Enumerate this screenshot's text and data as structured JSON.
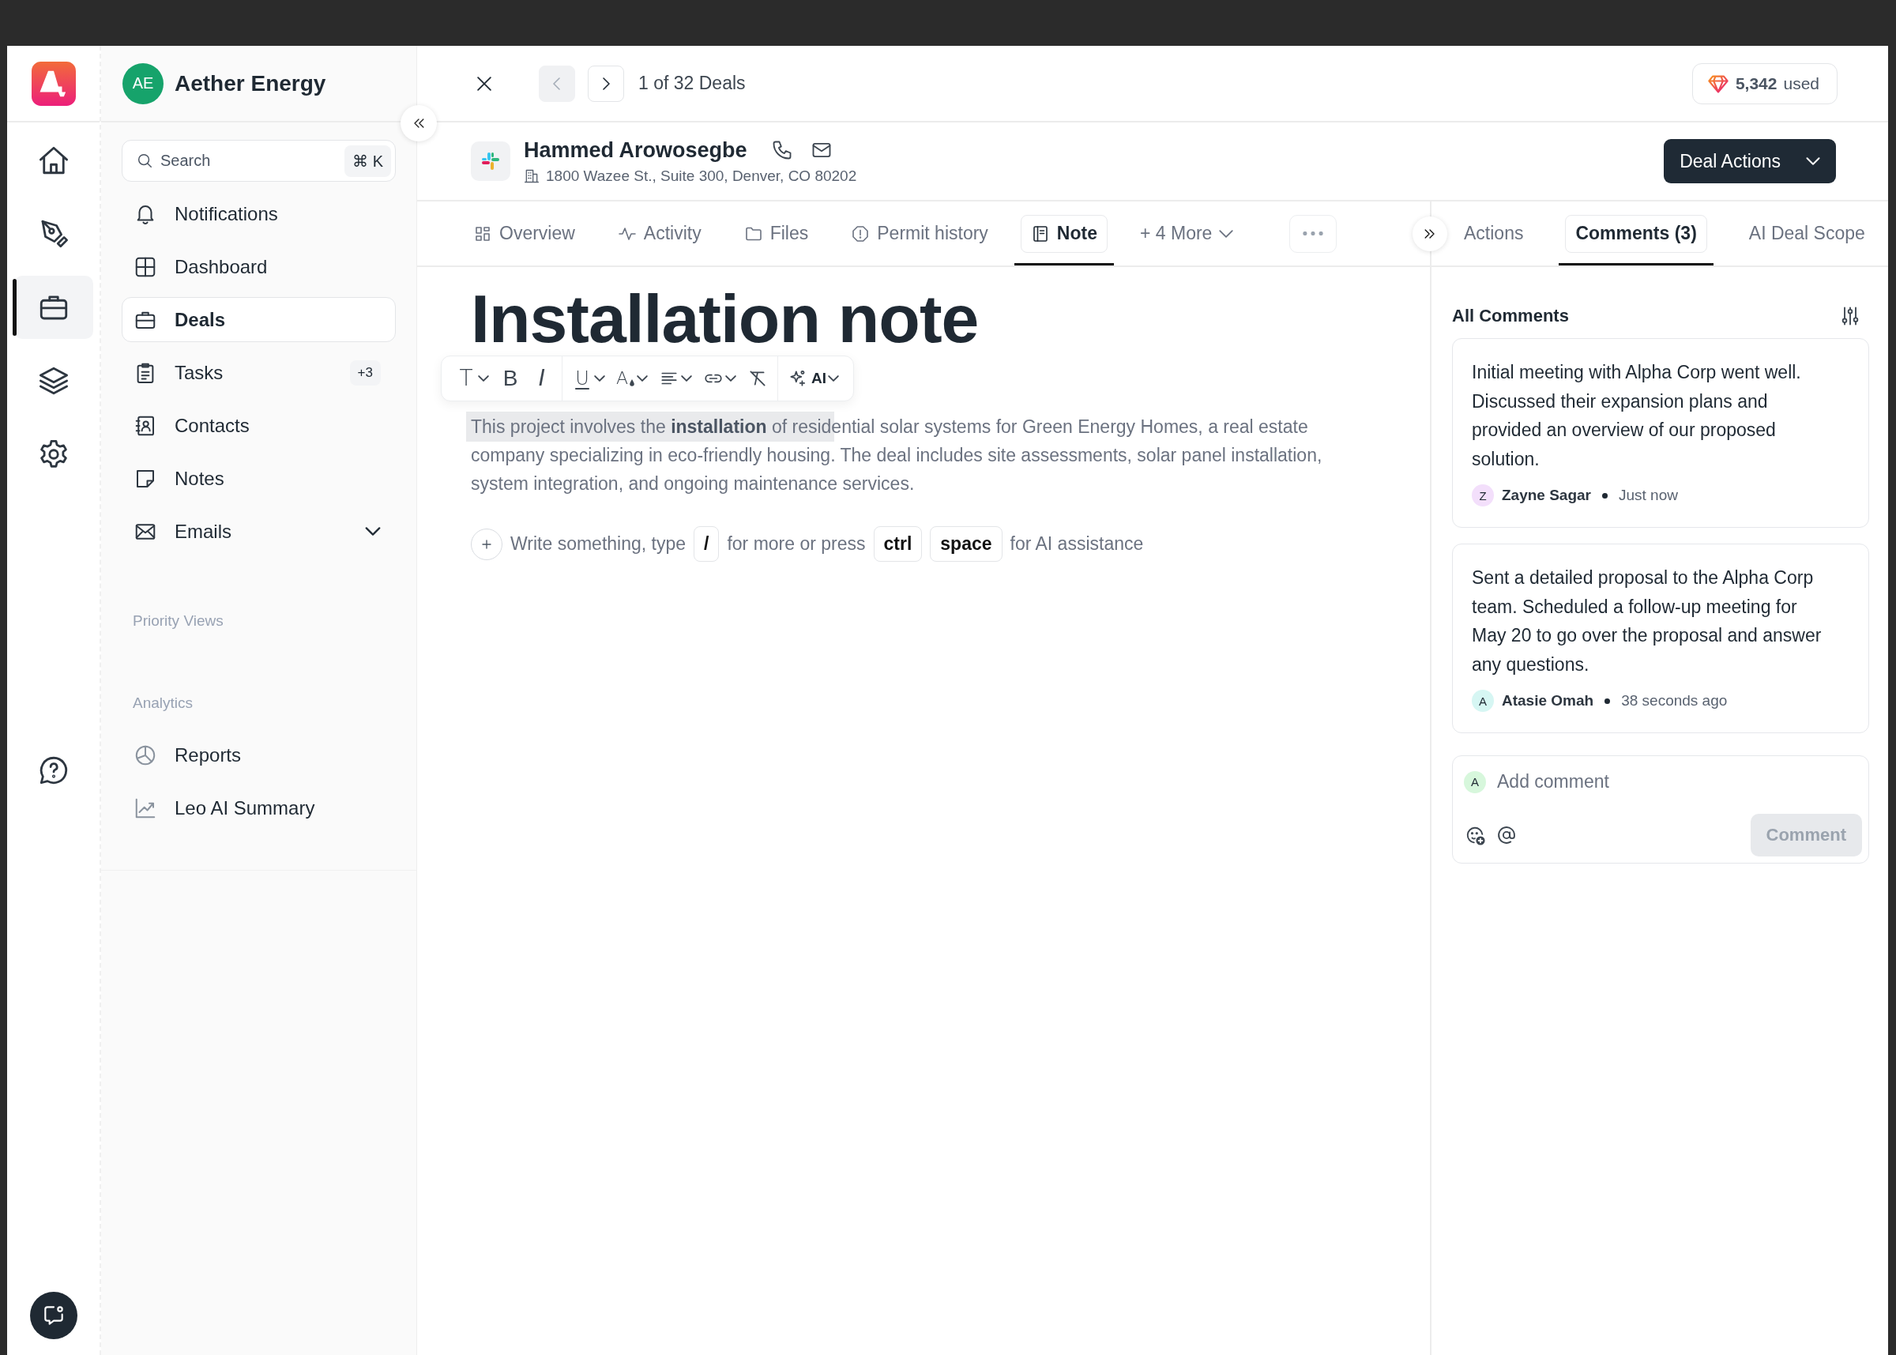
{
  "rail": {
    "items": [
      {
        "kind": "home",
        "selected": false
      },
      {
        "kind": "pen",
        "selected": false
      },
      {
        "kind": "briefcase",
        "selected": true
      },
      {
        "kind": "layers",
        "selected": false
      },
      {
        "kind": "gear",
        "selected": false
      }
    ]
  },
  "workspace": {
    "initials": "AE",
    "name": "Aether Energy"
  },
  "search": {
    "placeholder": "Search",
    "shortcut": "⌘ K"
  },
  "nav_items": [
    {
      "kind": "bell",
      "label": "Notifications",
      "selected": false,
      "collapsible": false
    },
    {
      "kind": "dashboard",
      "label": "Dashboard",
      "selected": false,
      "collapsible": false
    },
    {
      "kind": "briefcase",
      "label": "Deals",
      "selected": true,
      "collapsible": false
    },
    {
      "kind": "tasks",
      "label": "Tasks",
      "selected": false,
      "collapsible": false,
      "badge": "+3"
    },
    {
      "kind": "contacts",
      "label": "Contacts",
      "selected": false,
      "collapsible": false
    },
    {
      "kind": "notes",
      "label": "Notes",
      "selected": false,
      "collapsible": false
    },
    {
      "kind": "mail",
      "label": "Emails",
      "selected": false,
      "collapsible": true
    }
  ],
  "sections": [
    {
      "title": "Priority Views"
    },
    {
      "title": "Analytics",
      "items": [
        {
          "kind": "reports",
          "label": "Reports",
          "selected": false
        },
        {
          "kind": "summary",
          "label": "Leo AI Summary",
          "selected": false
        }
      ]
    }
  ],
  "record_nav": {
    "position": "1 of 32 Deals",
    "prev_disabled": true,
    "next_disabled": false
  },
  "credits": {
    "count": "5,342",
    "unit": "used"
  },
  "contact": {
    "name": "Hammed Arowosegbe",
    "address": "1800 Wazee St., Suite 300, Denver, CO 80202"
  },
  "primary_action": "Deal Actions",
  "tabs": [
    {
      "kind": "overview",
      "label": "Overview",
      "selected": false
    },
    {
      "kind": "activity",
      "label": "Activity",
      "selected": false
    },
    {
      "kind": "files",
      "label": "Files",
      "selected": false
    },
    {
      "kind": "permit",
      "label": "Permit history",
      "selected": false
    },
    {
      "kind": "note",
      "label": "Note",
      "selected": true
    },
    {
      "kind": "more",
      "label": "+ 4 More",
      "selected": false
    }
  ],
  "side_tabs": [
    {
      "label": "Actions",
      "selected": false
    },
    {
      "label": "Comments (3)",
      "selected": true
    },
    {
      "label": "AI Deal Scope",
      "selected": false
    }
  ],
  "note": {
    "title": "Installation note",
    "body": "This project involves the **installation** of residential solar systems for Green Energy Homes, a real estate company specializing in eco-friendly housing. The deal includes site assessments, solar panel installation, system integration, and ongoing maintenance services.",
    "prompt": [
      {
        "kind": "text",
        "text": "Write something, type"
      },
      {
        "kind": "key",
        "text": "/"
      },
      {
        "kind": "text",
        "text": "for more or press"
      },
      {
        "kind": "key",
        "text": "ctrl"
      },
      {
        "kind": "key",
        "text": "space"
      },
      {
        "kind": "text",
        "text": "for AI assistance"
      }
    ]
  },
  "toolbar": [
    [
      {
        "kind": "text-style",
        "glyph": "T",
        "dropdown": true
      },
      {
        "kind": "bold",
        "glyph": "B",
        "dropdown": false
      },
      {
        "kind": "italic",
        "glyph": "I",
        "dropdown": false
      }
    ],
    [
      {
        "kind": "underline",
        "glyph": "U",
        "dropdown": true
      },
      {
        "kind": "color",
        "glyph": "A",
        "dropdown": true
      },
      {
        "kind": "align",
        "dropdown": true
      },
      {
        "kind": "link",
        "dropdown": true
      },
      {
        "kind": "clear",
        "dropdown": false
      }
    ],
    [
      {
        "kind": "ai",
        "glyph": "AI",
        "dropdown": true
      }
    ]
  ],
  "comments": {
    "title": "All Comments",
    "items": [
      {
        "text": "Initial meeting with Alpha Corp went well. Discussed their expansion plans and provided an overview of our proposed solution.",
        "initial": "Z",
        "color": "#f3dffb",
        "author": "Zayne Sagar",
        "time": "Just now"
      },
      {
        "text": "Sent a detailed proposal to the Alpha Corp team. Scheduled a follow-up meeting for May 20 to go over the proposal and answer any questions.",
        "initial": "A",
        "color": "#d6f6f3",
        "author": "Atasie Omah",
        "time": "38 seconds ago"
      }
    ],
    "composer": {
      "initial": "A",
      "placeholder": "Add comment",
      "button": "Comment",
      "button_disabled": true
    }
  }
}
